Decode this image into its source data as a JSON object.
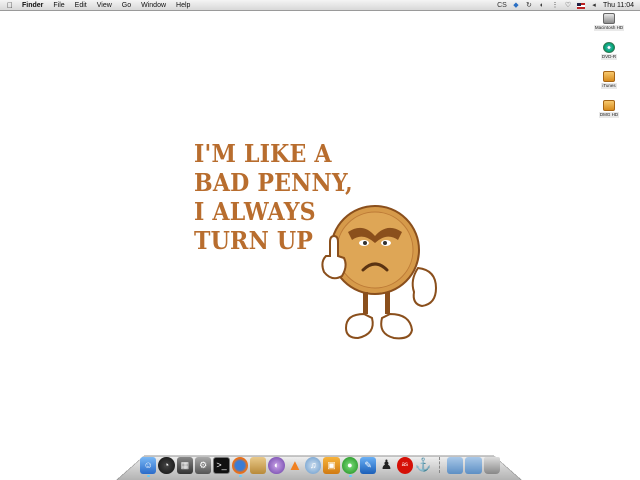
{
  "menubar": {
    "apple": "",
    "items": [
      "Finder",
      "File",
      "Edit",
      "View",
      "Go",
      "Window",
      "Help"
    ],
    "status": {
      "cs_label": "CS",
      "clock": "Thu 11:04"
    }
  },
  "desktop_icons": [
    {
      "label": "Macintosh HD",
      "icon": "hard-drive-icon"
    },
    {
      "label": "DVD-R",
      "icon": "disc-icon"
    },
    {
      "label": "iTunes",
      "icon": "folder-icon"
    },
    {
      "label": "DMG HD",
      "icon": "folder-icon"
    }
  ],
  "wallpaper": {
    "lines": [
      "I'M LIKE A",
      "BAD PENNY,",
      "I ALWAYS",
      "TURN UP"
    ],
    "color": "#b86d2e"
  },
  "dock": {
    "icons": [
      "finder-icon",
      "dashboard-icon",
      "expose-icon",
      "system-preferences-icon",
      "terminal-icon",
      "firefox-icon",
      "notes-icon",
      "eclipse-icon",
      "vlc-icon",
      "itunes-icon",
      "photo-booth-icon",
      "chat-icon",
      "xcode-icon",
      "guitar-icon",
      "lastfm-icon",
      "network-icon",
      "documents-folder-icon",
      "downloads-folder-icon",
      "trash-icon"
    ]
  }
}
